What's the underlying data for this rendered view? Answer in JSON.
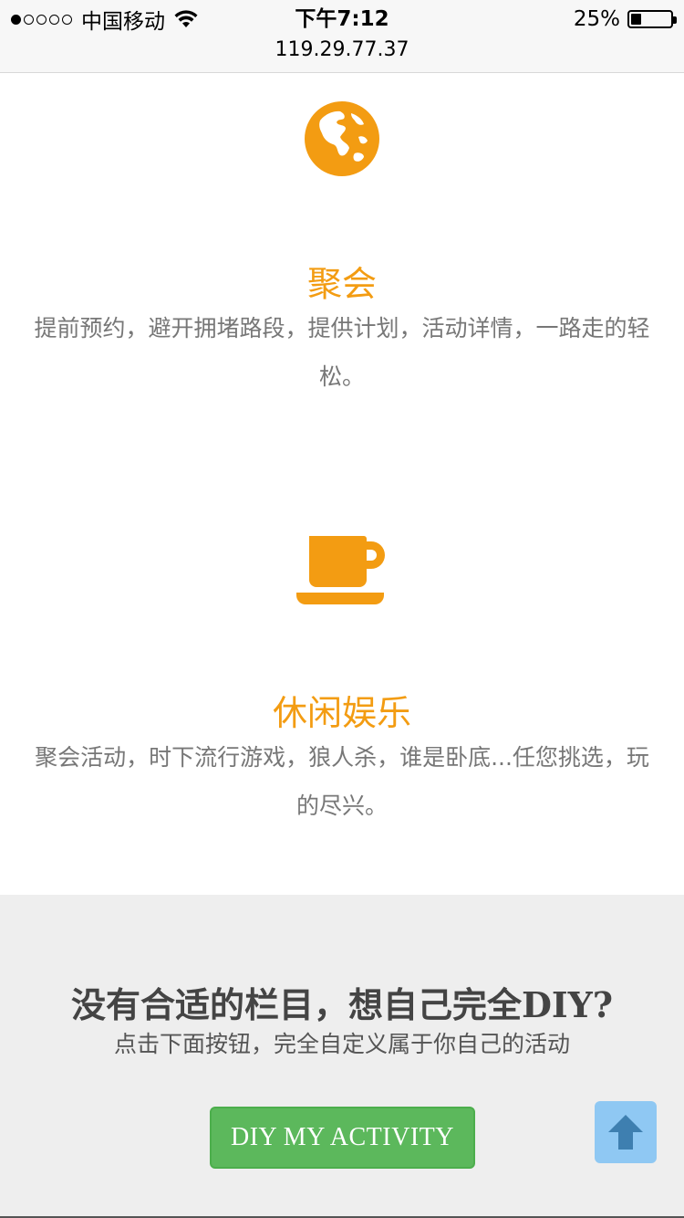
{
  "status_bar": {
    "signal_dots_filled": 1,
    "signal_dots_total": 5,
    "carrier": "中国移动",
    "time": "下午7:12",
    "battery_percent_text": "25%",
    "battery_level": 0.25,
    "url": "119.29.77.37"
  },
  "features": [
    {
      "icon": "globe-icon",
      "title": "聚会",
      "description": "提前预约，避开拥堵路段，提供计划，活动详情，一路走的轻松。"
    },
    {
      "icon": "coffee-cup-icon",
      "title": "休闲娱乐",
      "description": "聚会活动，时下流行游戏，狼人杀，谁是卧底...任您挑选，玩的尽兴。"
    }
  ],
  "cta": {
    "title": "没有合适的栏目，想自己完全DIY?",
    "subtitle": "点击下面按钮，完全自定义属于你自己的活动",
    "button_label": "DIY MY ACTIVITY",
    "back_to_top_icon": "arrow-up-icon"
  },
  "colors": {
    "accent": "#f39c12",
    "button_green": "#5cb85c",
    "back_to_top_bg": "#8fc8f3",
    "cta_bg": "#eeeeee"
  }
}
